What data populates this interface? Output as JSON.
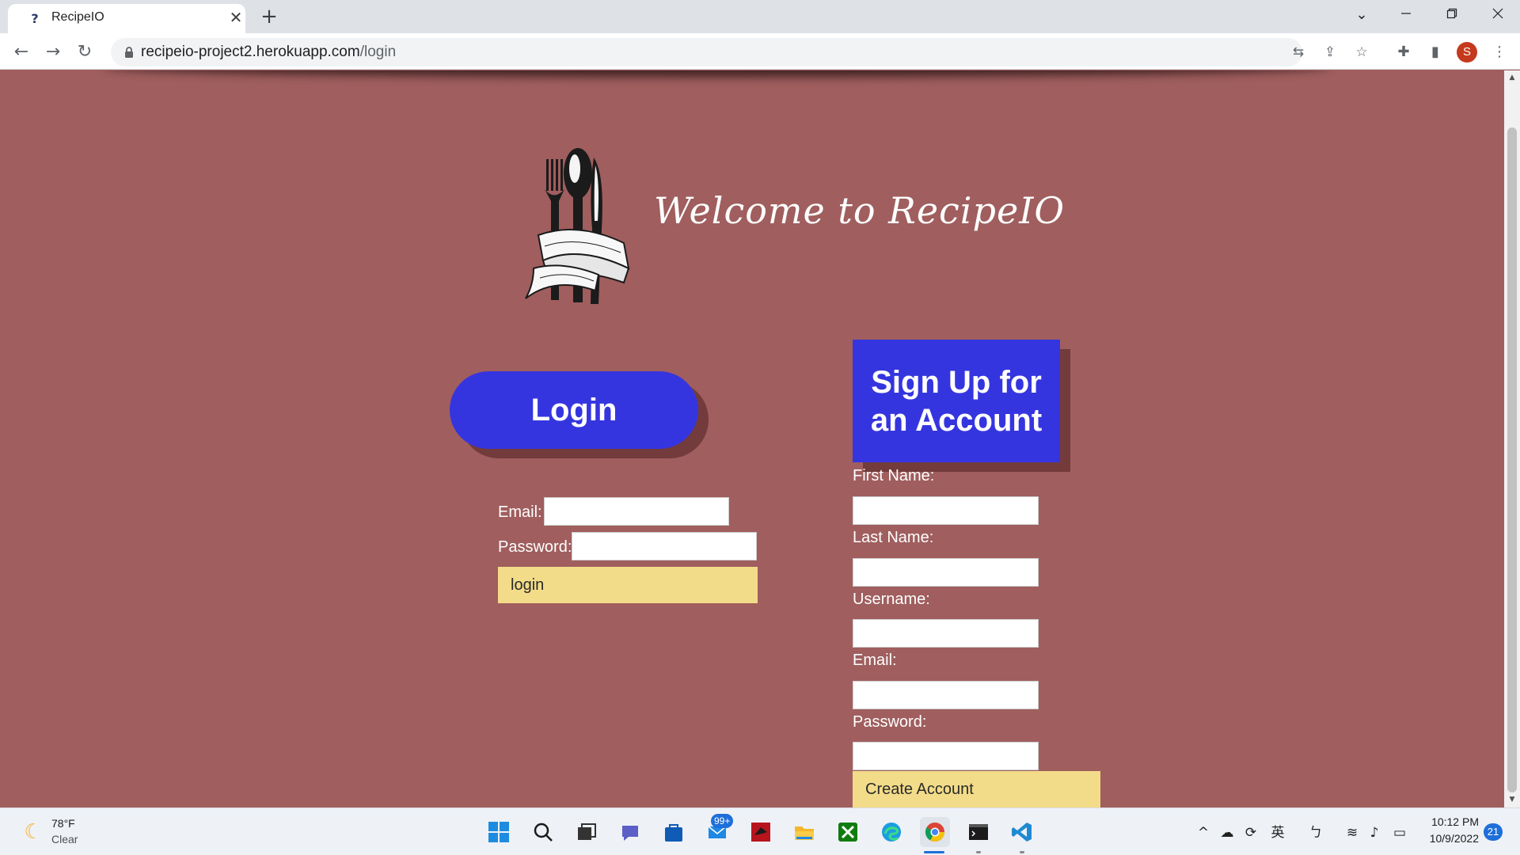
{
  "browser": {
    "tab_title": "RecipeIO",
    "tab_close": "✕",
    "new_tab": "+",
    "url_host": "recipeio-project2.herokuapp.com",
    "url_path": "/login",
    "profile_initial": "S"
  },
  "page": {
    "welcome_text": "Welcome to RecipeIO",
    "login_heading": "Login",
    "signup_heading": "Sign Up for an Account",
    "login_form": {
      "email_label": "Email:",
      "password_label": "Password:",
      "email_value": "",
      "password_value": "",
      "submit_label": "login"
    },
    "signup_form": {
      "first_name_label": "First Name:",
      "last_name_label": "Last Name:",
      "username_label": "Username:",
      "email_label": "Email:",
      "password_label": "Password:",
      "submit_label": "Create Account"
    }
  },
  "taskbar": {
    "weather_temp": "78°F",
    "weather_condition": "Clear",
    "mail_badge": "99+",
    "tray_language": "英",
    "clock_time": "10:12 PM",
    "clock_date": "10/9/2022",
    "notification_count": "21"
  },
  "colors": {
    "page_background": "#a05e5e",
    "heading_blue": "#3535e0",
    "button_yellow": "#f3dc89"
  }
}
